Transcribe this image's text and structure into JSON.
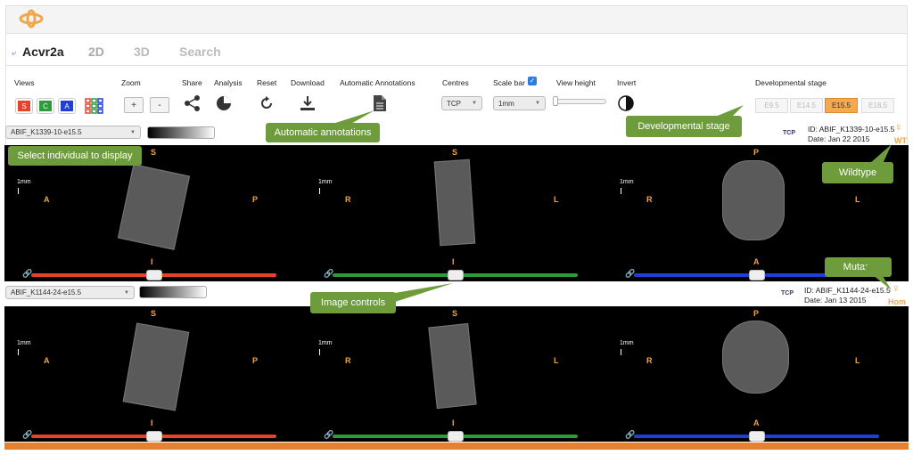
{
  "header": {
    "gene": "Acvr2a",
    "tabs": [
      "2D",
      "3D",
      "Search"
    ]
  },
  "toolbar": {
    "views_label": "Views",
    "view_buttons": [
      "S",
      "C",
      "A"
    ],
    "zoom_label": "Zoom",
    "zoom_in": "+",
    "zoom_out": "-",
    "share_label": "Share",
    "analysis_label": "Analysis",
    "reset_label": "Reset",
    "download_label": "Download",
    "annotations_label": "Automatic Annotations",
    "centres_label": "Centres",
    "centre_value": "TCP",
    "scalebar_label": "Scale bar",
    "scalebar_value": "1mm",
    "viewheight_label": "View height",
    "invert_label": "Invert",
    "stage_label": "Developmental stage",
    "stages": [
      "E9.5",
      "E14.5",
      "E15.5",
      "E18.5"
    ],
    "active_stage": "E15.5"
  },
  "rows": [
    {
      "specimen": "ABIF_K1339-10-e15.5",
      "centre_badge": "TCP",
      "id": "ID: ABIF_K1339-10-e15.5",
      "date": "Date: Jan 22 2015",
      "genotype": "WT",
      "panels": [
        {
          "top": "S",
          "left": "A",
          "right": "P",
          "bottom": "I",
          "scale": "1mm",
          "slider": 0.5
        },
        {
          "top": "S",
          "left": "R",
          "right": "L",
          "bottom": "I",
          "scale": "1mm",
          "slider": 0.5
        },
        {
          "top": "P",
          "left": "R",
          "right": "L",
          "bottom": "A",
          "scale": "1mm",
          "slider": 0.5
        }
      ]
    },
    {
      "specimen": "ABIF_K1144-24-e15.5",
      "centre_badge": "TCP",
      "id": "ID: ABIF_K1144-24-e15.5",
      "date": "Date: Jan 13 2015",
      "genotype": "Hom",
      "panels": [
        {
          "top": "S",
          "left": "A",
          "right": "P",
          "bottom": "I",
          "scale": "1mm",
          "slider": 0.5
        },
        {
          "top": "S",
          "left": "R",
          "right": "L",
          "bottom": "I",
          "scale": "1mm",
          "slider": 0.5
        },
        {
          "top": "P",
          "left": "R",
          "right": "L",
          "bottom": "A",
          "scale": "1mm",
          "slider": 0.5
        }
      ]
    }
  ],
  "callouts": {
    "select_individual": "Select individual to display",
    "automatic_annotations": "Automatic annotations",
    "developmental_stage": "Developmental stage",
    "wildtype": "Wildtype",
    "mutant": "Mutant",
    "image_controls": "Image controls"
  },
  "colors": {
    "sagittal": "#e8412c",
    "coronal": "#2e9b3a",
    "axial": "#1f3fd8",
    "accent": "#f0a64a",
    "callout": "#6e9b3c"
  }
}
